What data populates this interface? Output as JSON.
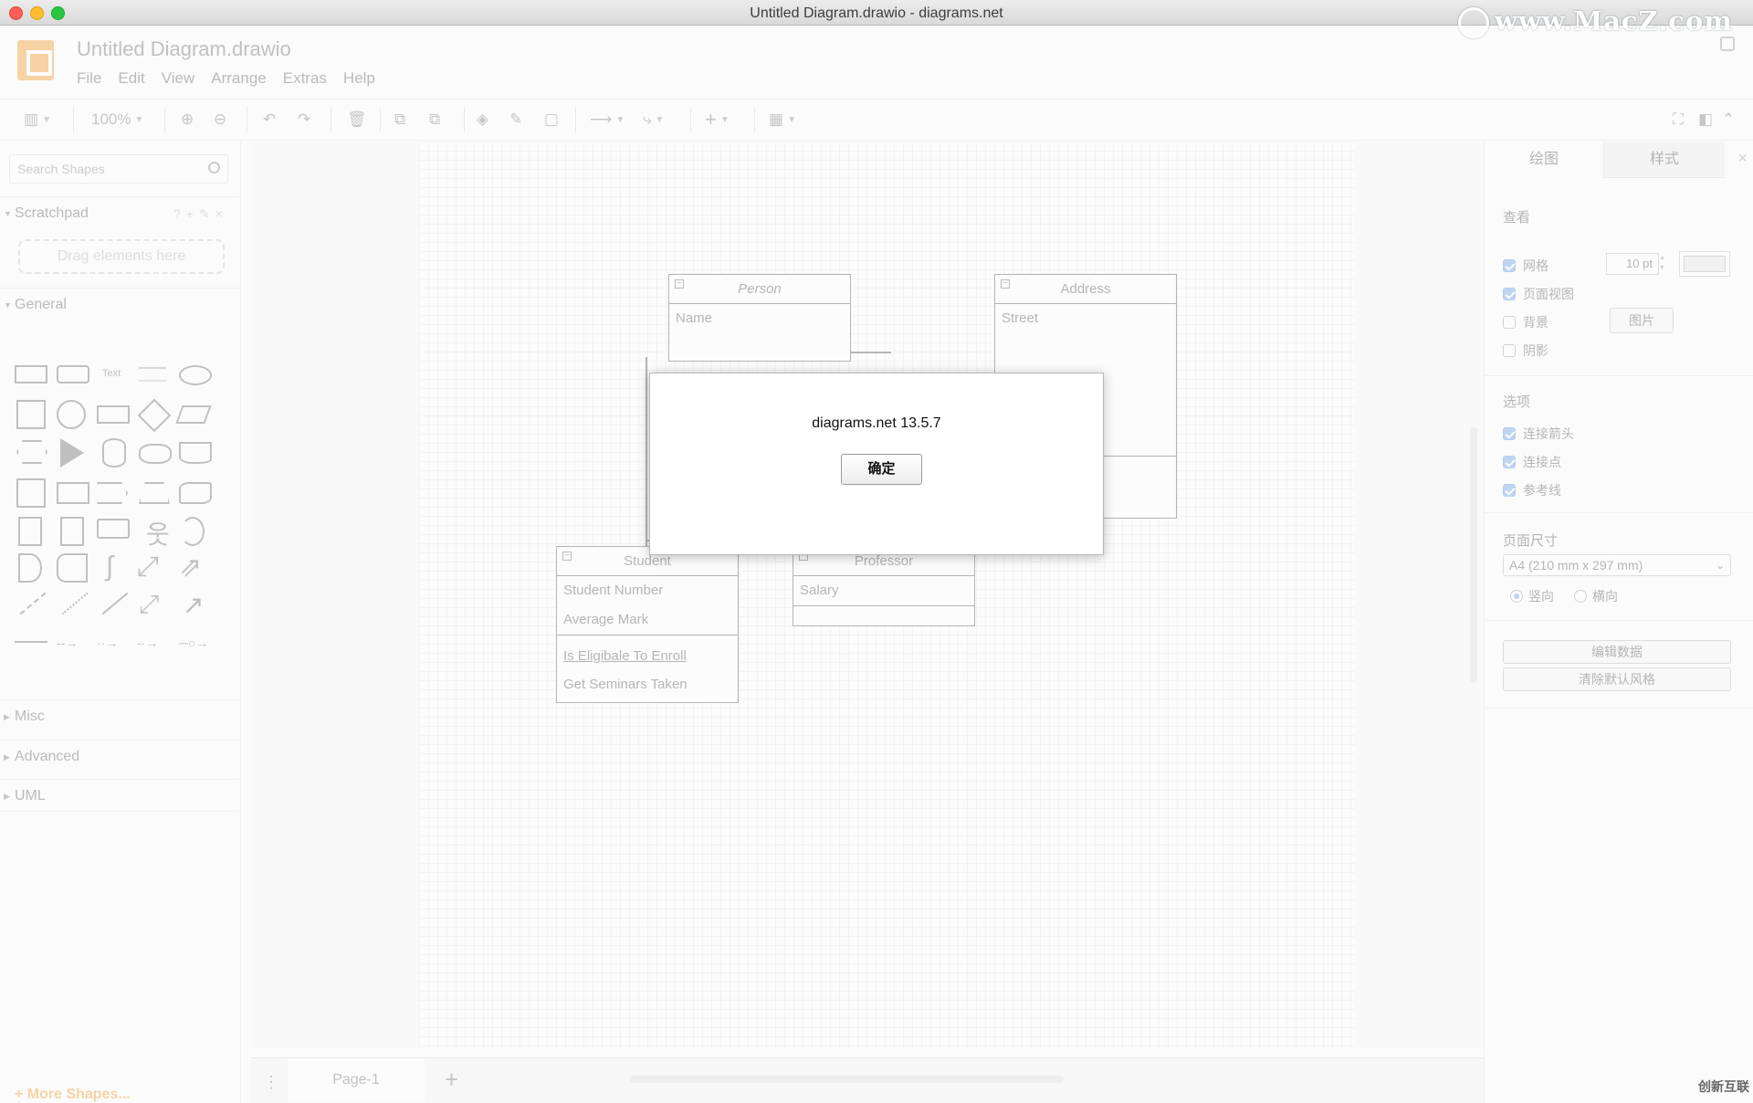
{
  "window": {
    "title": "Untitled Diagram.drawio - diagrams.net",
    "watermark": "www.MacZ.com"
  },
  "header": {
    "doc_title": "Untitled Diagram.drawio",
    "menus": [
      "File",
      "Edit",
      "View",
      "Arrange",
      "Extras",
      "Help"
    ]
  },
  "toolbar": {
    "zoom": "100%"
  },
  "sidebar": {
    "search_placeholder": "Search Shapes",
    "scratchpad": {
      "title": "Scratchpad",
      "drop_text": "Drag elements here"
    },
    "general_title": "General",
    "text_shape_label": "Text",
    "sections": [
      "Misc",
      "Advanced",
      "UML"
    ],
    "more_shapes": "+ More Shapes..."
  },
  "diagram": {
    "person": {
      "title": "Person",
      "attributes": [
        "Name"
      ]
    },
    "address": {
      "title": "Address",
      "attributes": [
        "Street"
      ]
    },
    "student": {
      "title": "Student",
      "attributes": [
        "Student Number",
        "Average Mark"
      ],
      "methods": [
        "Is Eligibale To Enroll",
        "Get Seminars Taken"
      ]
    },
    "professor": {
      "title": "Professor",
      "attributes": [
        "Salary"
      ]
    }
  },
  "tabs": {
    "page_tab": "Page-1"
  },
  "right_panel": {
    "tabs": [
      "绘图",
      "样式"
    ],
    "view_title": "查看",
    "view_options": [
      {
        "label": "网格",
        "checked": true
      },
      {
        "label": "页面视图",
        "checked": true
      },
      {
        "label": "背景",
        "checked": false
      },
      {
        "label": "阴影",
        "checked": false
      }
    ],
    "grid_size": "10 pt",
    "bg_image_button": "图片",
    "options_title": "选项",
    "options": [
      {
        "label": "连接箭头",
        "checked": true
      },
      {
        "label": "连接点",
        "checked": true
      },
      {
        "label": "参考线",
        "checked": true
      }
    ],
    "page_size_title": "页面尺寸",
    "page_size_value": "A4 (210 mm x 297 mm)",
    "orientation": [
      {
        "label": "竖向",
        "selected": true
      },
      {
        "label": "横向",
        "selected": false
      }
    ],
    "buttons": [
      "编辑数据",
      "清除默认风格"
    ]
  },
  "dialog": {
    "message": "diagrams.net 13.5.7",
    "ok_label": "确定"
  },
  "footer_watermark": "创新互联",
  "colors": {
    "brand_orange": "#f08705",
    "checkbox_blue": "#4a90e2"
  }
}
